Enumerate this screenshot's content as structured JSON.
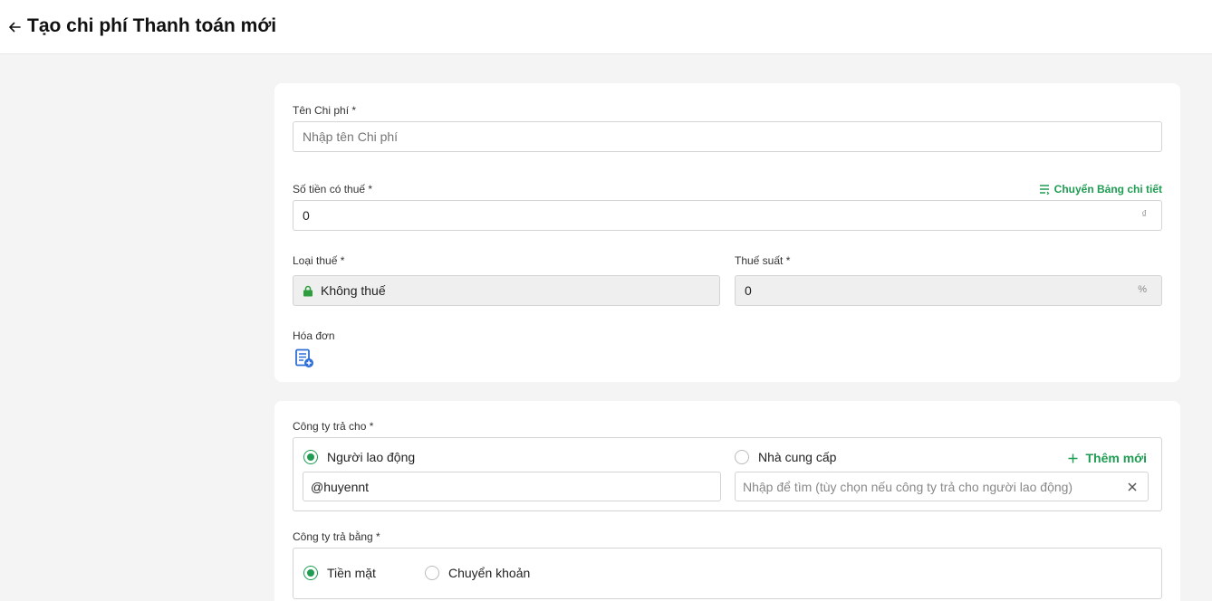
{
  "header": {
    "title": "Tạo chi phí Thanh toán mới"
  },
  "expense_name": {
    "label": "Tên Chi phí *",
    "placeholder": "Nhập tên Chi phí",
    "value": ""
  },
  "amount": {
    "label": "Số tiền có thuế *",
    "value": "0",
    "currency": "₫",
    "switch_link": "Chuyển Bảng chi tiết"
  },
  "tax_type": {
    "label": "Loại thuế *",
    "value": "Không thuế"
  },
  "tax_rate": {
    "label": "Thuế suất *",
    "value": "0",
    "unit": "%"
  },
  "invoice": {
    "label": "Hóa đơn"
  },
  "paid_to": {
    "label": "Công ty trả cho *",
    "options": [
      {
        "label": "Người lao động",
        "checked": true
      },
      {
        "label": "Nhà cung cấp",
        "checked": false
      }
    ],
    "add_new": "Thêm mới",
    "employee_value": "@huyennt",
    "supplier_placeholder": "Nhập để tìm (tùy chọn nếu công ty trả cho người lao động)"
  },
  "paid_by": {
    "label": "Công ty trả bằng *",
    "options": [
      {
        "label": "Tiền mặt",
        "checked": true
      },
      {
        "label": "Chuyển khoản",
        "checked": false
      }
    ]
  },
  "colors": {
    "accent": "#1e9d52",
    "lock": "#2e9e3e",
    "icon_blue": "#2f6fd6"
  }
}
